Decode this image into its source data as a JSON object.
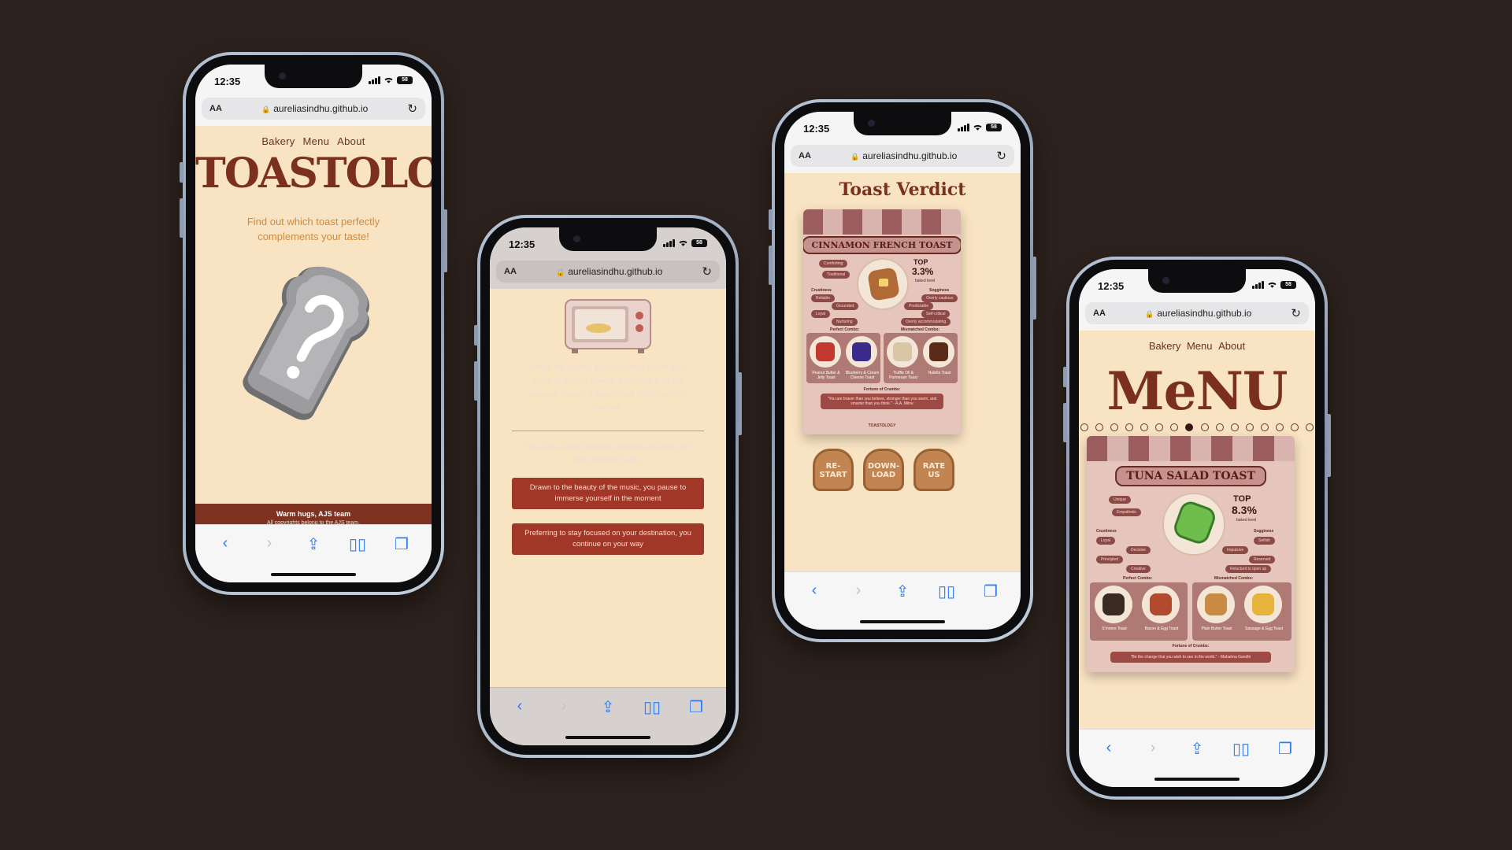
{
  "browser": {
    "time": "12:35",
    "battery": "58",
    "url_text_size": "AA",
    "url": "aureliasindhu.github.io"
  },
  "phone1": {
    "nav": [
      "Bakery",
      "Menu",
      "About"
    ],
    "brand": "TOASTOLOgy",
    "tagline": "Find out which toast perfectly complements your taste!",
    "footer_title": "Warm hugs, AJS team",
    "footer_sub": "All copyrights belong to the AJS team."
  },
  "phone2": {
    "story": "Exiting the bakery, you're greeted by the lively pulse of the city streets. Surrounded by the constant motion of people and traffic, you feel excited.",
    "question": "You spot a street performer wowing everyone with their amazing music.",
    "choices": [
      "Drawn to the beauty of the music, you pause to immerse yourself in the moment",
      "Preferring to stay focused on your destination, you continue on your way"
    ]
  },
  "phone3": {
    "title": "Toast Verdict",
    "card": {
      "banner": "CINNAMON FRENCH TOAST",
      "top_label": "TOP",
      "top_value": "3.3%",
      "top_sub": "baked level",
      "traits": [
        "Comforting",
        "Traditional"
      ],
      "crustiness_label": "Crustiness",
      "sogginess_label": "Sogginess",
      "crustiness": [
        "Reliable",
        "Grounded",
        "Loyal",
        "Nurturing"
      ],
      "sogginess": [
        "Overly cautious",
        "Predictable",
        "Self-critical",
        "Overly accommodating"
      ],
      "perfect_label": "Perfect Combo:",
      "mismatch_label": "Mismatched Combo:",
      "perfect": [
        "Peanut Butter & Jelly Toast",
        "Blueberry & Cream Cheese Toast"
      ],
      "mismatch": [
        "Truffle Oil & Parmesan Toast",
        "Nutella Toast"
      ],
      "fortune_label": "Fortune of Crumbs:",
      "fortune": "\"You are braver than you believe, stronger than you seem, and smarter than you think.\" - A.A. Milne",
      "footer_brand": "TOASTOLOGY"
    },
    "buttons": [
      "RE-START",
      "DOWN-LOAD",
      "RATE US"
    ]
  },
  "phone4": {
    "nav": [
      "Bakery",
      "Menu",
      "About"
    ],
    "title": "MeNU",
    "dots_total": 16,
    "dots_active_index": 7,
    "card": {
      "banner": "TUNA SALAD TOAST",
      "top_label": "TOP",
      "top_value": "8.3%",
      "top_sub": "baked level",
      "traits": [
        "Unique",
        "Empathetic"
      ],
      "crustiness_label": "Crustiness",
      "sogginess_label": "Sogginess",
      "crustiness": [
        "Loyal",
        "Decisive",
        "Principled",
        "Creative"
      ],
      "sogginess": [
        "Selfish",
        "Impulsive",
        "Reserved",
        "Reluctant to open up"
      ],
      "perfect_label": "Perfect Combo:",
      "mismatch_label": "Mismatched Combo:",
      "perfect": [
        "S'mores Toast",
        "Bacon & Egg Toast"
      ],
      "mismatch": [
        "Plain Butter Toast",
        "Sausage & Egg Toast"
      ],
      "fortune_label": "Fortune of Crumbs:",
      "fortune": "\"Be the change that you wish to see in the world.\" - Mahatma Gandhi"
    }
  }
}
